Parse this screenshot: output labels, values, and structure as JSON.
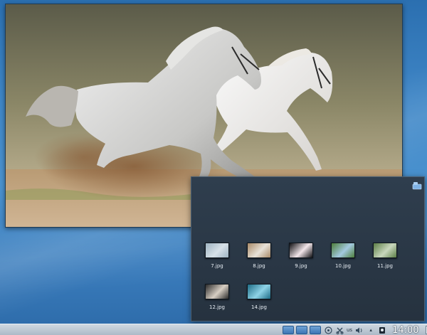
{
  "preview": {
    "image_alt": "Two white horses galloping through dust"
  },
  "folder_view": {
    "items": [
      {
        "label": "7.jpg",
        "thumb_colors": [
          "#9eb3c1",
          "#d7e1e8"
        ]
      },
      {
        "label": "8.jpg",
        "thumb_colors": [
          "#a88a68",
          "#e8e2d8"
        ]
      },
      {
        "label": "9.jpg",
        "thumb_colors": [
          "#0f0f12",
          "#f3e6ea"
        ]
      },
      {
        "label": "10.jpg",
        "thumb_colors": [
          "#4d7d3a",
          "#a3c9e0"
        ]
      },
      {
        "label": "11.jpg",
        "thumb_colors": [
          "#5b7d45",
          "#c9d7bd"
        ]
      },
      {
        "label": "12.jpg",
        "thumb_colors": [
          "#2a2a2a",
          "#d8cfc4"
        ]
      },
      {
        "label": "14.jpg",
        "thumb_colors": [
          "#1e6c86",
          "#8ed3e7"
        ]
      }
    ]
  },
  "panel": {
    "keyboard_layout": "us",
    "clock": "14:00"
  },
  "colors": {
    "popup_bg": "#2b3846",
    "panel_bg": "#b9c6d3",
    "accent": "#3b76b4"
  }
}
